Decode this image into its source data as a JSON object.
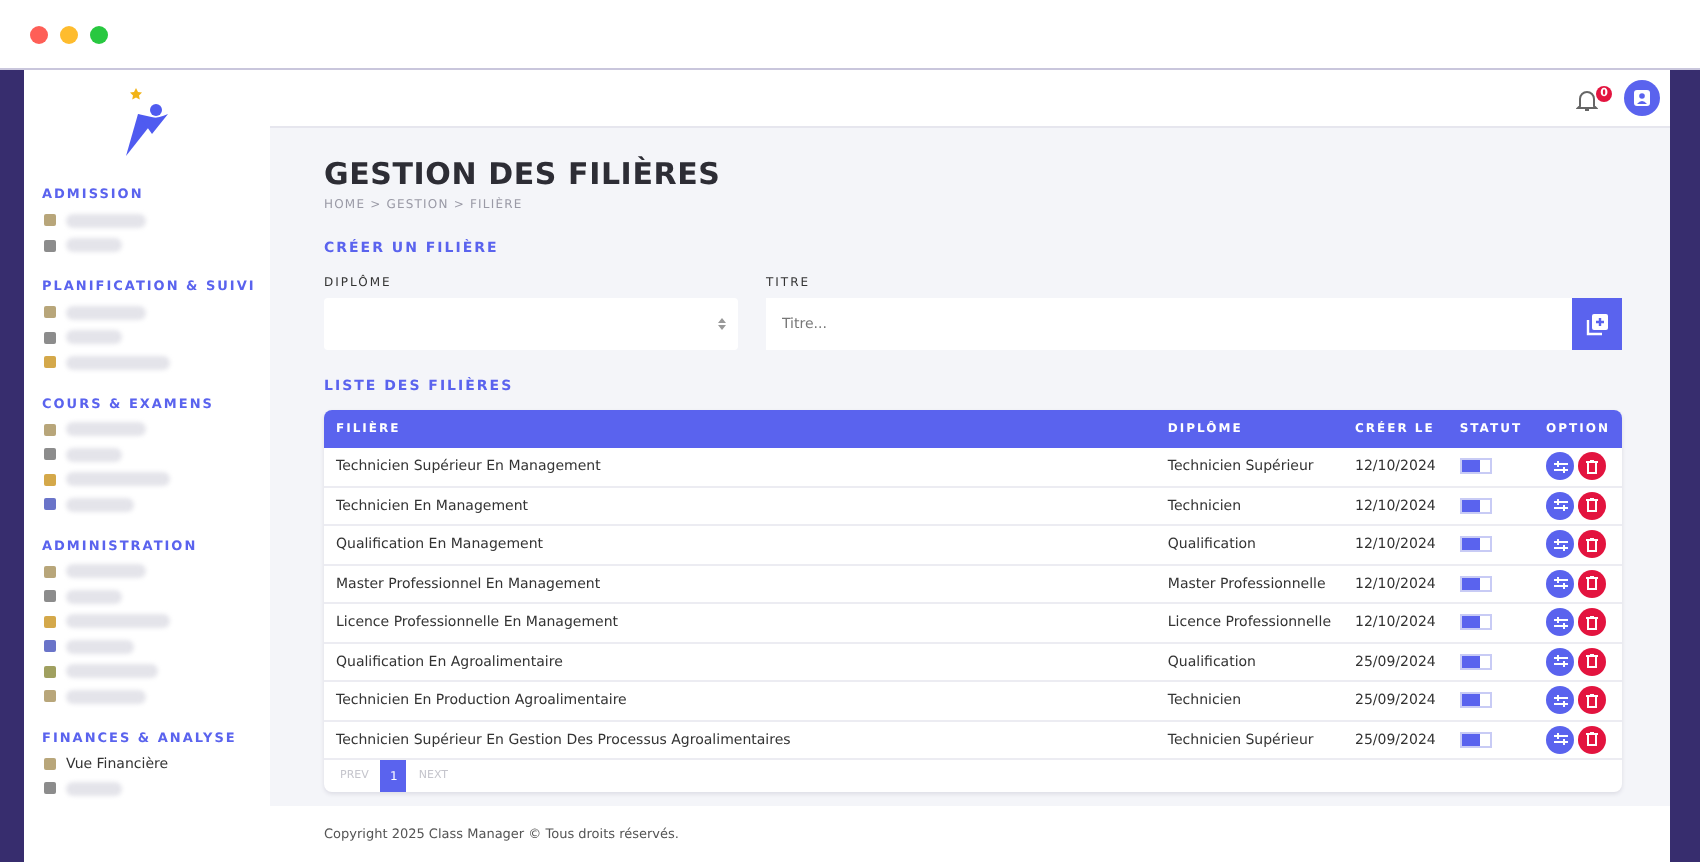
{
  "topbar": {
    "notification_count": "0"
  },
  "sidebar": {
    "sections": [
      {
        "heading": "ADMISSION",
        "items": [
          {
            "kind": "blurred"
          },
          {
            "kind": "blurred"
          }
        ]
      },
      {
        "heading": "PLANIFICATION & SUIVI",
        "items": [
          {
            "kind": "blurred"
          },
          {
            "kind": "blurred"
          },
          {
            "kind": "blurred"
          }
        ]
      },
      {
        "heading": "COURS & EXAMENS",
        "items": [
          {
            "kind": "blurred"
          },
          {
            "kind": "blurred"
          },
          {
            "kind": "blurred"
          },
          {
            "kind": "blurred"
          }
        ]
      },
      {
        "heading": "ADMINISTRATION",
        "items": [
          {
            "kind": "blurred"
          },
          {
            "kind": "blurred"
          },
          {
            "kind": "blurred"
          },
          {
            "kind": "blurred"
          },
          {
            "kind": "blurred"
          },
          {
            "kind": "blurred"
          }
        ]
      },
      {
        "heading": "FINANCES & ANALYSE",
        "items": [
          {
            "kind": "text",
            "label": "Vue Financière"
          },
          {
            "kind": "blurred"
          }
        ]
      }
    ]
  },
  "page": {
    "title": "GESTION DES FILIÈRES",
    "breadcrumb": "HOME > GESTION > FILIÈRE"
  },
  "form": {
    "heading": "CRÉER UN FILIÈRE",
    "diploma_label": "DIPLÔME",
    "title_label": "TITRE",
    "title_placeholder": "Titre..."
  },
  "table": {
    "heading": "LISTE DES FILIÈRES",
    "columns": [
      "FILIÈRE",
      "DIPLÔME",
      "CRÉER LE",
      "STATUT",
      "OPTION"
    ],
    "rows": [
      {
        "filiere": "Technicien Supérieur En Management",
        "diplome": "Technicien Supérieur",
        "date": "12/10/2024",
        "on": true
      },
      {
        "filiere": "Technicien En Management",
        "diplome": "Technicien",
        "date": "12/10/2024",
        "on": true
      },
      {
        "filiere": "Qualification En Management",
        "diplome": "Qualification",
        "date": "12/10/2024",
        "on": true
      },
      {
        "filiere": "Master Professionnel En Management",
        "diplome": "Master Professionnelle",
        "date": "12/10/2024",
        "on": true
      },
      {
        "filiere": "Licence Professionnelle En Management",
        "diplome": "Licence Professionnelle",
        "date": "12/10/2024",
        "on": true
      },
      {
        "filiere": "Qualification En Agroalimentaire",
        "diplome": "Qualification",
        "date": "25/09/2024",
        "on": true
      },
      {
        "filiere": "Technicien En Production Agroalimentaire",
        "diplome": "Technicien",
        "date": "25/09/2024",
        "on": true
      },
      {
        "filiere": "Technicien Supérieur En Gestion Des Processus Agroalimentaires",
        "diplome": "Technicien Supérieur",
        "date": "25/09/2024",
        "on": true
      }
    ],
    "pagination": {
      "prev": {
        "label": "PREV",
        "disabled": true
      },
      "pages": [
        {
          "label": "1",
          "selected": true
        }
      ],
      "next": {
        "label": "NEXT",
        "disabled": true
      }
    }
  },
  "footer": {
    "text": "Copyright 2025 Class Manager © Tous droits réservés."
  }
}
